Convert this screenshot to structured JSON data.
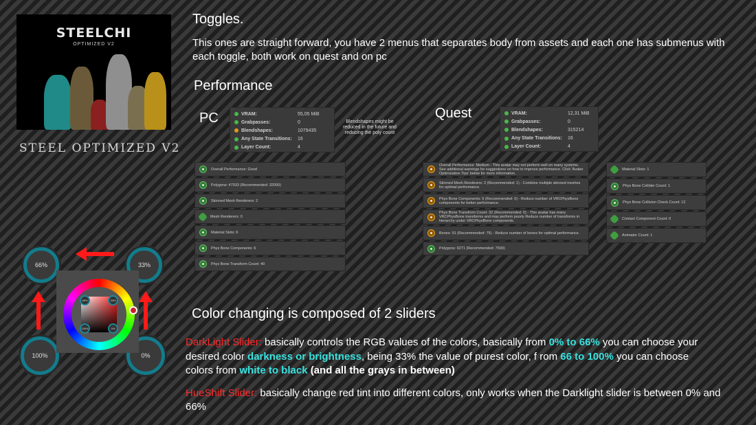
{
  "cover": {
    "title": "STEELCHI",
    "subtitle": "OPTIMIZED V2",
    "caption": "STEEL OPTIMIZED V2"
  },
  "toggles": {
    "heading": "Toggles.",
    "body": "This ones are straight forward, you have 2 menus that separates body from assets and each one has submenus with each toggle, both work on quest and on pc"
  },
  "performance": {
    "heading": "Performance",
    "pc_label": "PC",
    "quest_label": "Quest",
    "blendshape_note": "Blendshapes might be reduced in the future and reducing the poly count",
    "pc_stats": [
      {
        "key": "VRAM:",
        "value": "55,05 MiB",
        "status": "green"
      },
      {
        "key": "Grabpasses:",
        "value": "0",
        "status": "green"
      },
      {
        "key": "Blendshapes:",
        "value": "1079435",
        "status": "orange"
      },
      {
        "key": "Any State Transitions:",
        "value": "16",
        "status": "green"
      },
      {
        "key": "Layer Count:",
        "value": "4",
        "status": "green"
      }
    ],
    "quest_stats": [
      {
        "key": "VRAM:",
        "value": "12,31 MiB",
        "status": "green"
      },
      {
        "key": "Grabpasses:",
        "value": "0",
        "status": "green"
      },
      {
        "key": "Blendshapes:",
        "value": "315214",
        "status": "green"
      },
      {
        "key": "Any State Transitions:",
        "value": "16",
        "status": "green"
      },
      {
        "key": "Layer Count:",
        "value": "4",
        "status": "green"
      }
    ],
    "pc_items": [
      {
        "text": "Overall Performance: Good",
        "icon": "green-circle-icon"
      },
      {
        "text": "Polygons: 47933 (Recommended: 32000)",
        "icon": "green-circle-icon"
      },
      {
        "text": "Skinned Mesh Renderers: 2",
        "icon": "green-circle-icon"
      },
      {
        "text": "Mesh Renderers: 0",
        "icon": "green-star-icon"
      },
      {
        "text": "Material Slots: 6",
        "icon": "green-circle-icon"
      },
      {
        "text": "Phys Bone Components: 6",
        "icon": "green-circle-icon"
      },
      {
        "text": "Phys Bone Transform Count: 40",
        "icon": "green-circle-icon"
      }
    ],
    "quest_items": [
      {
        "text": "Overall Performance: Medium - This avatar may not perform well on many systems. See additional warnings for suggestions on how to improve performance. Click 'Avatar Optimization Tips' below for more information.",
        "icon": "orange-circle-icon"
      },
      {
        "text": "Skinned Mesh Renderers: 2 (Recommended: 1) - Combine multiple skinned meshes for optimal performance.",
        "icon": "orange-circle-icon"
      },
      {
        "text": "Phys Bone Components: 6 (Recommended: 0) - Reduce number of VRCPhysBone components for better performance.",
        "icon": "orange-circle-icon"
      },
      {
        "text": "Phys Bone Transform Count: 32 (Recommended: 0) - This avatar has many VRCPhysBone transforms and may perform poorly Reduce number of transforms in hierarchy under VRCPhysBone components.",
        "icon": "orange-circle-icon"
      },
      {
        "text": "Bones: 91 (Recommended: 75) - Reduce number of bones for optimal performance.",
        "icon": "orange-circle-icon"
      },
      {
        "text": "Polygons: 9271 (Recommended: 7500)",
        "icon": "green-circle-icon"
      }
    ],
    "quest_items_right": [
      {
        "text": "Material Slots: 1",
        "icon": "green-star-icon"
      },
      {
        "text": "Phys Bone Collider Count: 1",
        "icon": "green-circle-icon"
      },
      {
        "text": "Phys Bone Collision Check Count: 12",
        "icon": "green-circle-icon"
      },
      {
        "text": "Contact Component Count: 0",
        "icon": "green-star-icon"
      },
      {
        "text": "Animator Count: 1",
        "icon": "green-star-icon"
      }
    ]
  },
  "widget": {
    "knob_tl": "66%",
    "knob_tr": "33%",
    "knob_bl": "100%",
    "knob_br": "0%",
    "mini_tl": "66%",
    "mini_tr": "33%",
    "mini_bl": "100%",
    "mini_br": "0%"
  },
  "color": {
    "heading": "Color changing is composed of 2 sliders",
    "dark_label": "DarkLight Slider:",
    "dark_t1": " basically controls the RGB values of the colors, basically from ",
    "dark_h1": "0% to 66%",
    "dark_t2": " you can choose your desired color ",
    "dark_h2": "darkness or brightness",
    "dark_t3": ", being 33% the value of purest color, f rom ",
    "dark_h3": "66 to 100%",
    "dark_t4": " you can choose colors from ",
    "dark_h4": "white to black",
    "dark_b1": " (and all the grays in between)",
    "hue_label": "HueShift Slider:",
    "hue_text": " basically change red tint into different colors, only works when the Darklight slider is between 0% and 66%"
  },
  "colors": {
    "accent_cyan": "#37e3e0",
    "accent_red": "#ff2a2a",
    "status_green": "#4ab84a",
    "status_orange": "#e09a1a",
    "knob_teal": "#1b8a9c"
  }
}
